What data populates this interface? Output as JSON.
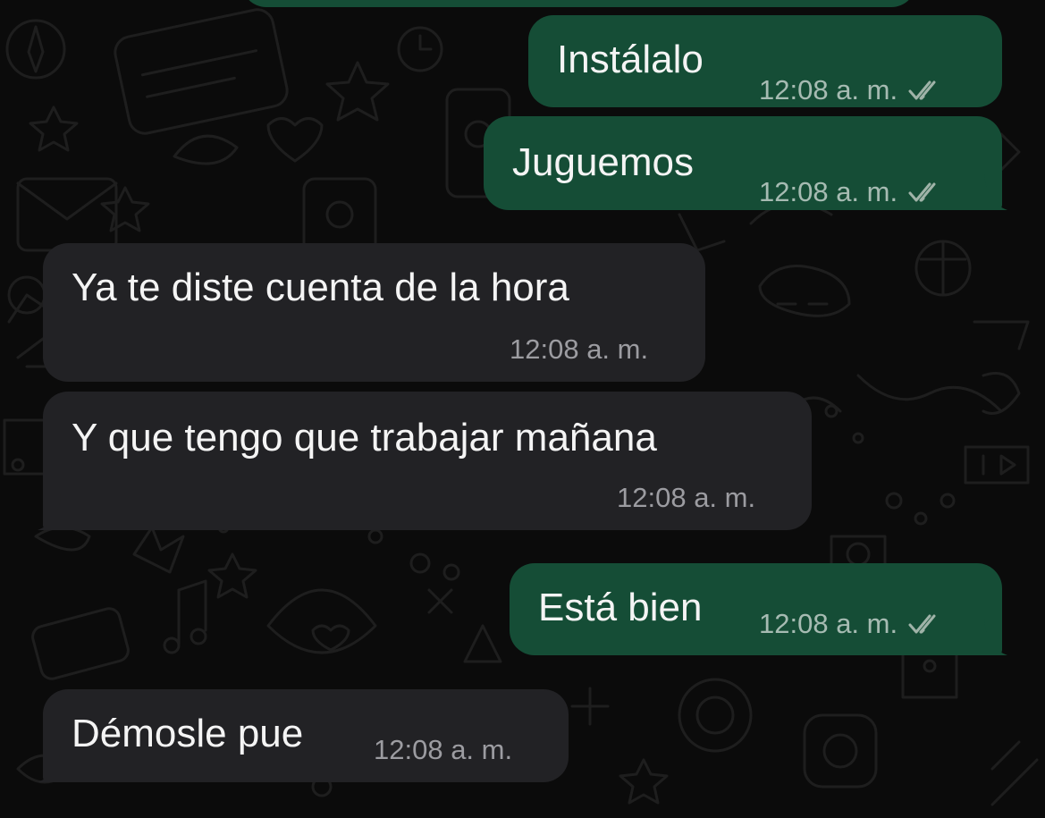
{
  "colors": {
    "background": "#0b0b0b",
    "outgoing_bubble": "#154d36",
    "incoming_bubble": "#222225",
    "meta_text": "#9c9ca1",
    "read_ticks": "#9fb3a8"
  },
  "messages": [
    {
      "direction": "outgoing",
      "text": "Instálalo",
      "time": "12:08 a. m.",
      "status_icon": "double-check-icon"
    },
    {
      "direction": "outgoing",
      "text": "Juguemos",
      "time": "12:08 a. m.",
      "status_icon": "double-check-icon"
    },
    {
      "direction": "incoming",
      "text": "Ya te diste cuenta de la hora",
      "time": "12:08 a. m."
    },
    {
      "direction": "incoming",
      "text": "Y que tengo que trabajar mañana",
      "time": "12:08 a. m."
    },
    {
      "direction": "outgoing",
      "text": "Está bien",
      "time": "12:08 a. m.",
      "status_icon": "double-check-icon"
    },
    {
      "direction": "incoming",
      "text": "Démosle pue",
      "time": "12:08 a. m."
    }
  ]
}
